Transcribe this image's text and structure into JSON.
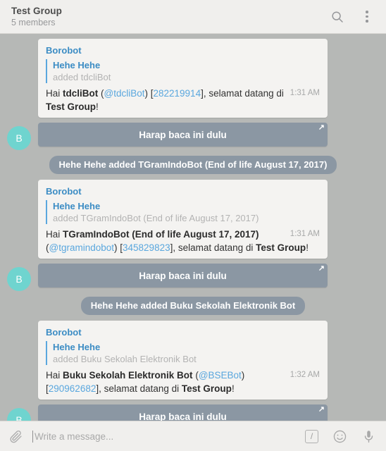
{
  "header": {
    "title": "Test Group",
    "subtitle": "5 members",
    "search_icon": "search-icon",
    "menu_icon": "more-vertical-icon"
  },
  "chat": {
    "avatar_letter": "B",
    "button_label": "Harap baca ini dulu",
    "button_external_icon": "↗",
    "messages": [
      {
        "author": "Borobot",
        "reply_name": "Hehe Hehe",
        "reply_text": "added tdcliBot",
        "text_parts": [
          {
            "t": "Hai ",
            "s": "plain"
          },
          {
            "t": "tdcliBot",
            "s": "bold"
          },
          {
            "t": " (",
            "s": "plain"
          },
          {
            "t": "@tdcliBot",
            "s": "link"
          },
          {
            "t": ") [",
            "s": "plain"
          },
          {
            "t": "282219914",
            "s": "link"
          },
          {
            "t": "], selamat datang di ",
            "s": "plain"
          },
          {
            "t": "Test Group",
            "s": "bold"
          },
          {
            "t": "!",
            "s": "plain"
          }
        ],
        "time": "1:31 AM"
      },
      {
        "author": "Borobot",
        "reply_name": "Hehe Hehe",
        "reply_text": "added TGramIndoBot (End of life August 17, 2017)",
        "text_parts": [
          {
            "t": "Hai ",
            "s": "plain"
          },
          {
            "t": "TGramIndoBot (End of life August 17, 2017)",
            "s": "bold"
          },
          {
            "t": " (",
            "s": "plain"
          },
          {
            "t": "@tgramindobot",
            "s": "link"
          },
          {
            "t": ") [",
            "s": "plain"
          },
          {
            "t": "345829823",
            "s": "link"
          },
          {
            "t": "], selamat datang di ",
            "s": "plain"
          },
          {
            "t": "Test Group",
            "s": "bold"
          },
          {
            "t": "!",
            "s": "plain"
          }
        ],
        "time": "1:31 AM"
      },
      {
        "author": "Borobot",
        "reply_name": "Hehe Hehe",
        "reply_text": "added Buku Sekolah Elektronik Bot",
        "text_parts": [
          {
            "t": "Hai ",
            "s": "plain"
          },
          {
            "t": "Buku Sekolah Elektronik Bot",
            "s": "bold"
          },
          {
            "t": " (",
            "s": "plain"
          },
          {
            "t": "@BSEBot",
            "s": "link"
          },
          {
            "t": ") [",
            "s": "plain"
          },
          {
            "t": "290962682",
            "s": "link"
          },
          {
            "t": "], selamat datang di ",
            "s": "plain"
          },
          {
            "t": "Test Group",
            "s": "bold"
          },
          {
            "t": "!",
            "s": "plain"
          }
        ],
        "time": "1:32 AM"
      }
    ],
    "service_messages": [
      "Hehe Hehe added TGramIndoBot (End of life August 17, 2017)",
      "Hehe Hehe added Buku Sekolah Elektronik Bot"
    ]
  },
  "composer": {
    "attach_icon": "paperclip-icon",
    "placeholder": "Write a message...",
    "value": "",
    "command_label": "/",
    "emoji_icon": "smiley-icon",
    "mic_icon": "microphone-icon"
  },
  "colors": {
    "chat_background": "#b6b8b6",
    "bubble": "#f4f3f1",
    "accent_blue": "#5aa7de",
    "service_gray": "#8b97a3",
    "avatar_teal": "#6fd4cf",
    "header_bg": "#f0efed"
  }
}
